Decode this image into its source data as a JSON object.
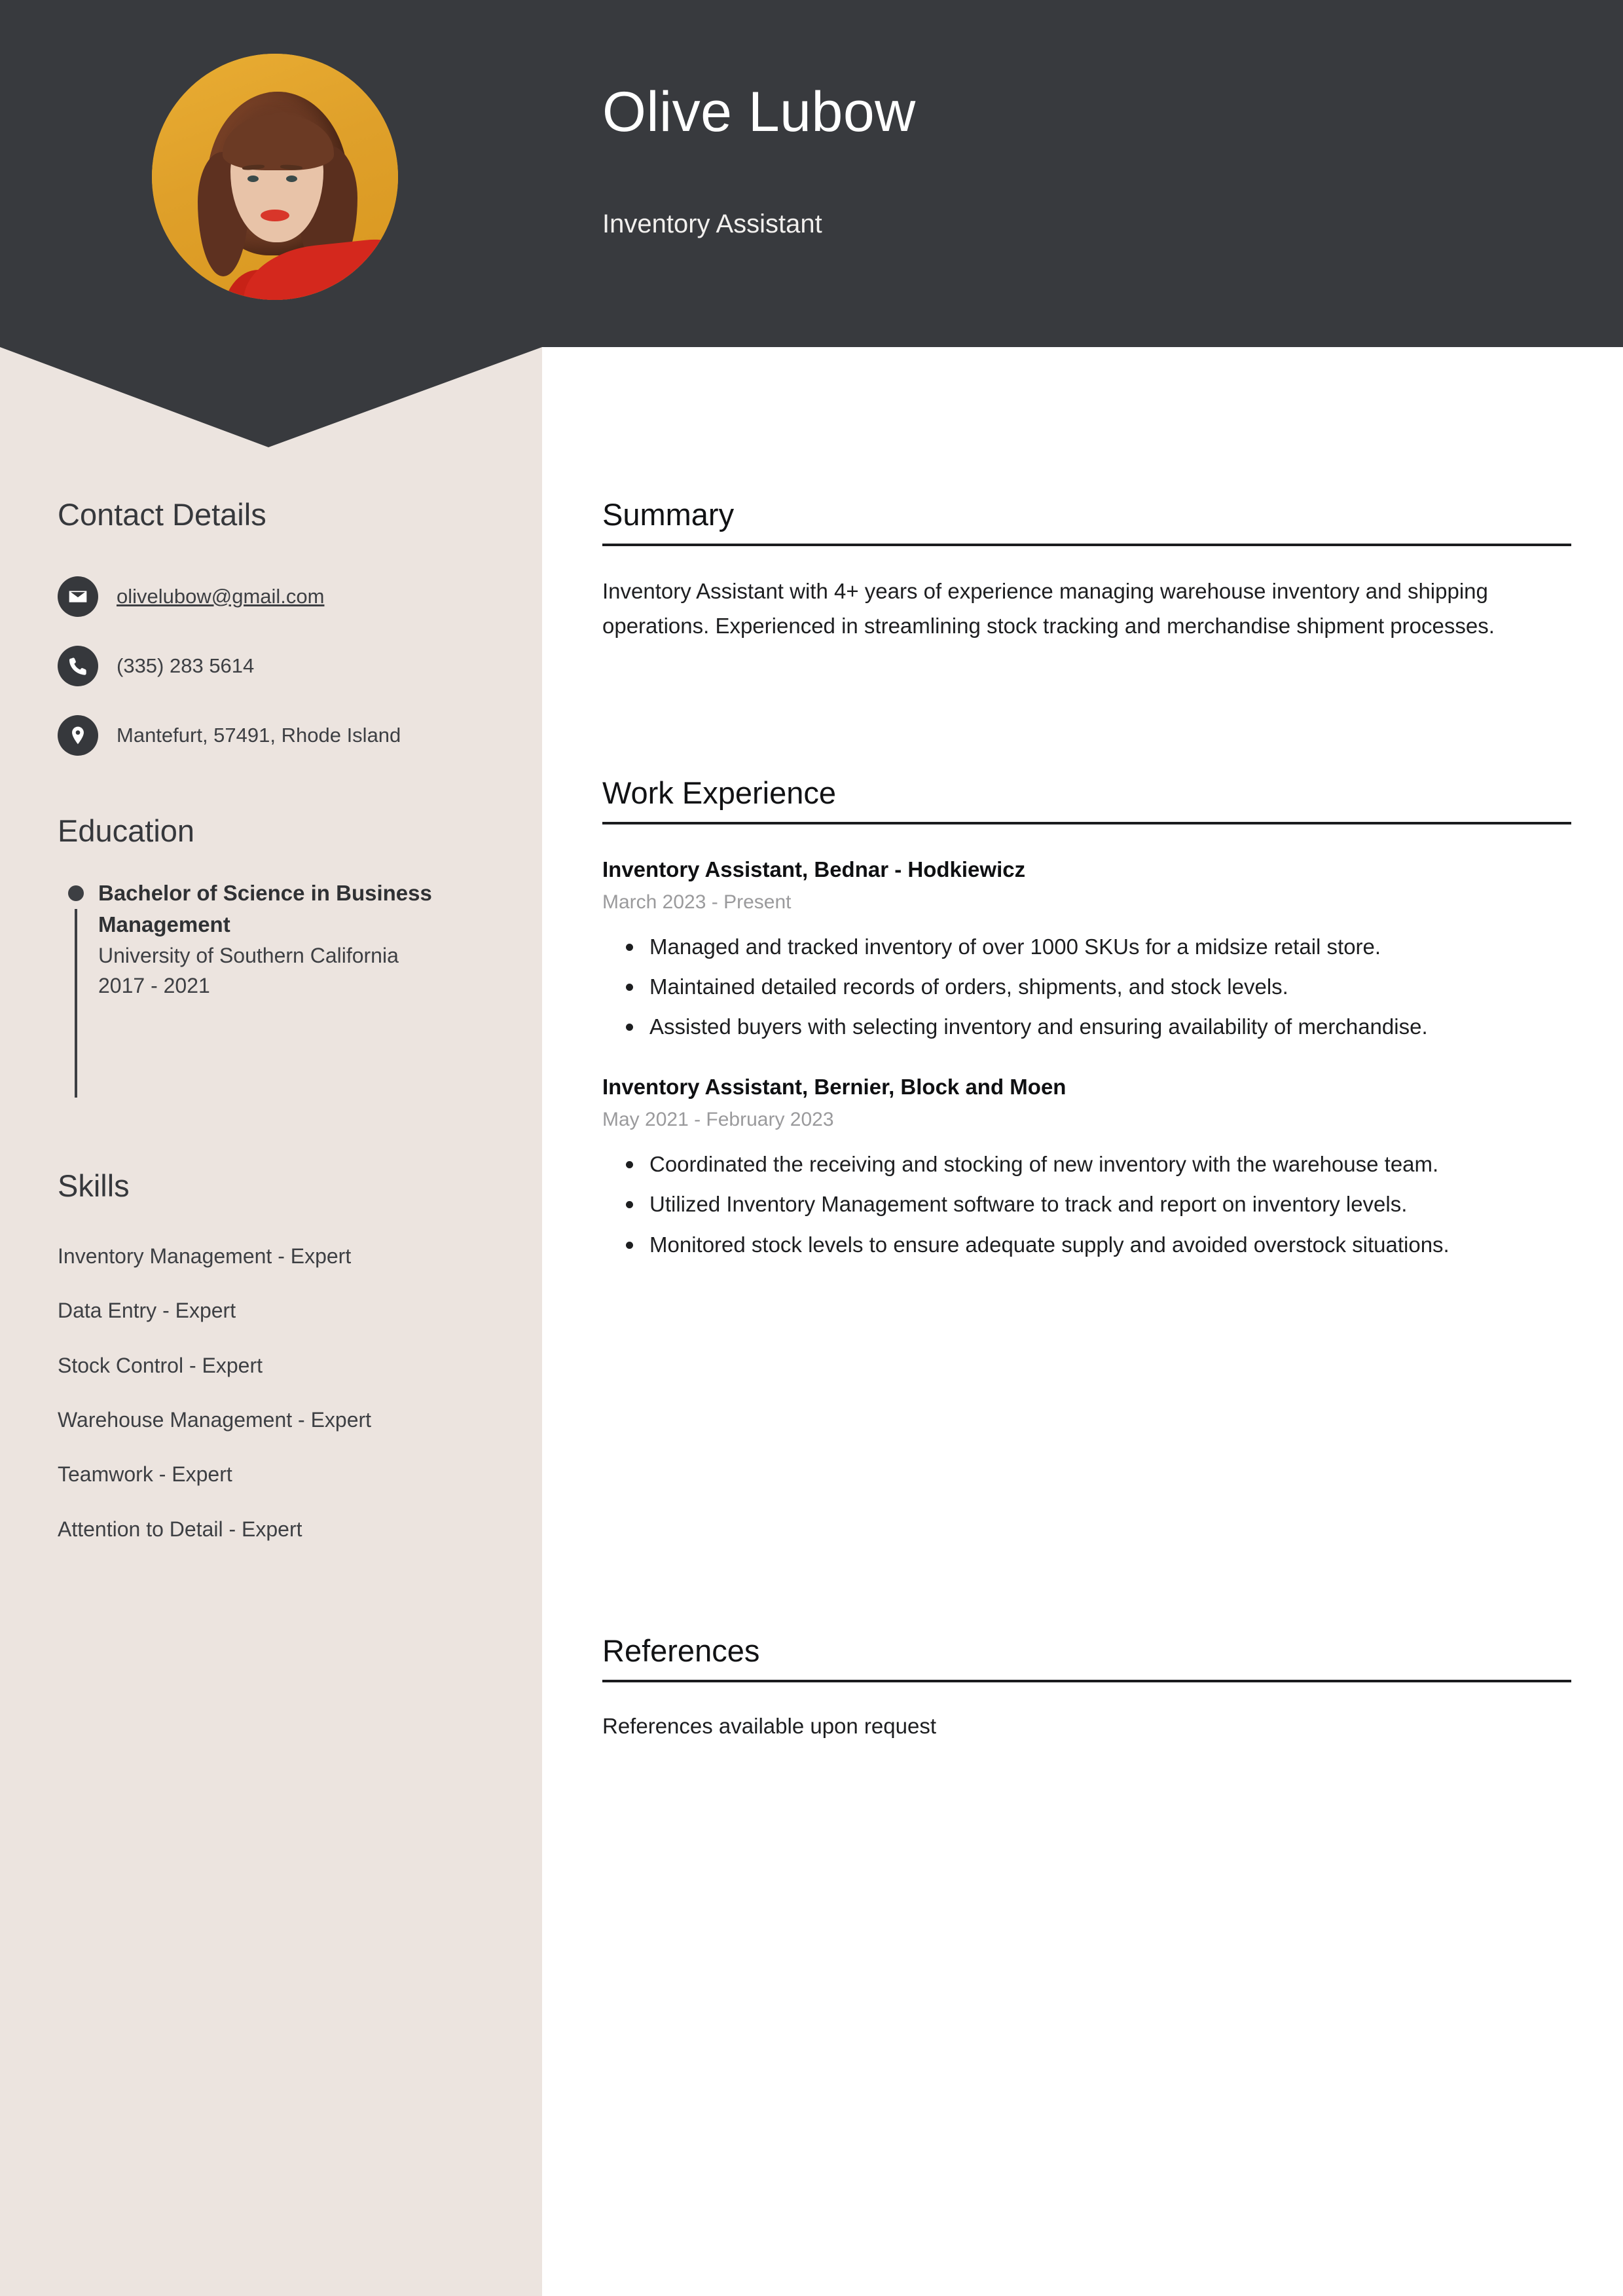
{
  "theme": {
    "header_bg": "#383a3e",
    "sidebar_bg": "#ece4df",
    "main_bg": "#ffffff",
    "text_dark": "#1d1e20",
    "muted_text": "#9a9a9c",
    "avatar_bg": "#e0a32e"
  },
  "header": {
    "name": "Olive Lubow",
    "role": "Inventory Assistant",
    "avatar_alt": "portrait-photo"
  },
  "sidebar": {
    "contact": {
      "heading": "Contact Details",
      "items": [
        {
          "icon": "envelope-icon",
          "value": "olivelubow@gmail.com",
          "kind": "email"
        },
        {
          "icon": "phone-icon",
          "value": "(335) 283 5614",
          "kind": "phone"
        },
        {
          "icon": "location-pin-icon",
          "value": "Mantefurt, 57491, Rhode Island",
          "kind": "address"
        }
      ]
    },
    "education": {
      "heading": "Education",
      "items": [
        {
          "degree": "Bachelor of Science in Business Management",
          "school": "University of Southern California",
          "years": "2017 - 2021"
        }
      ]
    },
    "skills": {
      "heading": "Skills",
      "items": [
        "Inventory Management - Expert",
        "Data Entry - Expert",
        "Stock Control - Expert",
        "Warehouse Management - Expert",
        "Teamwork - Expert",
        "Attention to Detail - Expert"
      ]
    }
  },
  "main": {
    "summary": {
      "heading": "Summary",
      "text": "Inventory Assistant with 4+ years of experience managing warehouse inventory and shipping operations. Experienced in streamlining stock tracking and merchandise shipment processes."
    },
    "work": {
      "heading": "Work Experience",
      "jobs": [
        {
          "title": "Inventory Assistant, Bednar - Hodkiewicz",
          "date": "March 2023 - Present",
          "bullets": [
            "Managed and tracked inventory of over 1000 SKUs for a midsize retail store.",
            "Maintained detailed records of orders, shipments, and stock levels.",
            "Assisted buyers with selecting inventory and ensuring availability of merchandise."
          ]
        },
        {
          "title": "Inventory Assistant, Bernier, Block and Moen",
          "date": "May 2021 - February 2023",
          "bullets": [
            "Coordinated the receiving and stocking of new inventory with the warehouse team.",
            "Utilized Inventory Management software to track and report on inventory levels.",
            "Monitored stock levels to ensure adequate supply and avoided overstock situations."
          ]
        }
      ]
    },
    "references": {
      "heading": "References",
      "text": "References available upon request"
    }
  }
}
